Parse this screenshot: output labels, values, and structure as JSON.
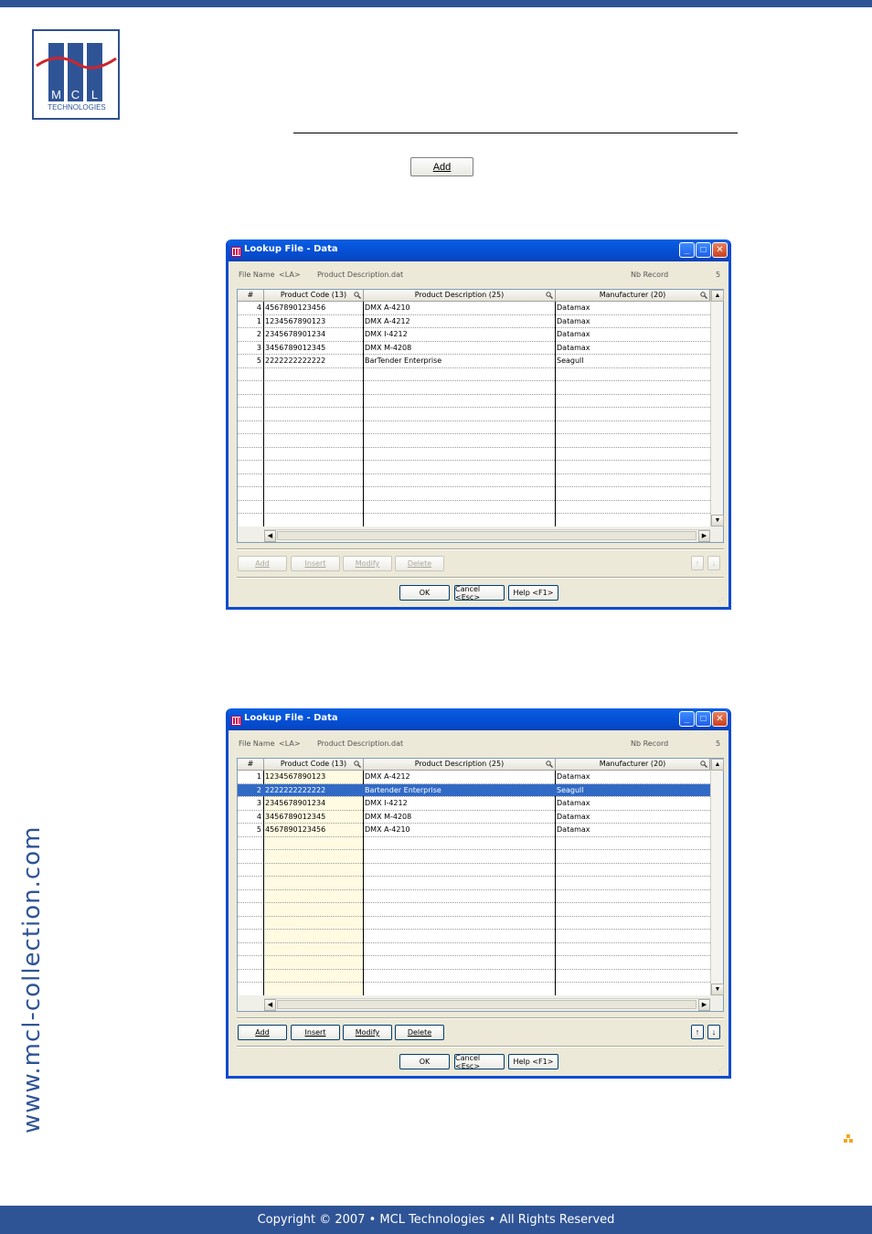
{
  "logo": {
    "letters": [
      "M",
      "C",
      "L"
    ],
    "subtitle": "TECHNOLOGIES"
  },
  "doc": {
    "add_button": "Add"
  },
  "side_url": "www.mcl-collection.com",
  "footer": "Copyright © 2007 • MCL Technologies • All Rights Reserved",
  "colors": {
    "brand": "#2f5496",
    "title_bar": "#0553d8",
    "selection": "#316ac5",
    "accent": "#f5a623"
  },
  "windows": [
    {
      "title": "Lookup File - Data",
      "file_name_label": "File Name",
      "file_name_value": "<LA>",
      "file_path": "Product Description.dat",
      "nb_record_label": "Nb Record",
      "nb_record_value": "5",
      "columns": [
        "#",
        "Product Code (13)",
        "Product Description (25)",
        "Manufacturer (20)"
      ],
      "rows": [
        [
          "4",
          "4567890123456",
          "DMX A-4210",
          "Datamax"
        ],
        [
          "1",
          "1234567890123",
          "DMX A-4212",
          "Datamax"
        ],
        [
          "2",
          "2345678901234",
          "DMX I-4212",
          "Datamax"
        ],
        [
          "3",
          "3456789012345",
          "DMX M-4208",
          "Datamax"
        ],
        [
          "5",
          "2222222222222",
          "BarTender Enterprise",
          "Seagull"
        ]
      ],
      "selected_row": -1,
      "buttons_enabled": false,
      "buttons": {
        "add": "Add",
        "insert": "Insert",
        "modify": "Modify",
        "delete": "Delete",
        "ok": "OK",
        "cancel": "Cancel <Esc>",
        "help": "Help <F1>"
      }
    },
    {
      "title": "Lookup File - Data",
      "file_name_label": "File Name",
      "file_name_value": "<LA>",
      "file_path": "Product Description.dat",
      "nb_record_label": "Nb Record",
      "nb_record_value": "5",
      "columns": [
        "#",
        "Product Code (13)",
        "Product Description (25)",
        "Manufacturer (20)"
      ],
      "rows": [
        [
          "1",
          "1234567890123",
          "DMX A-4212",
          "Datamax"
        ],
        [
          "2",
          "2222222222222",
          "Bartender Enterprise",
          "Seagull"
        ],
        [
          "3",
          "2345678901234",
          "DMX I-4212",
          "Datamax"
        ],
        [
          "4",
          "3456789012345",
          "DMX M-4208",
          "Datamax"
        ],
        [
          "5",
          "4567890123456",
          "DMX A-4210",
          "Datamax"
        ]
      ],
      "selected_row": 1,
      "buttons_enabled": true,
      "buttons": {
        "add": "Add",
        "insert": "Insert",
        "modify": "Modify",
        "delete": "Delete",
        "ok": "OK",
        "cancel": "Cancel <Esc>",
        "help": "Help <F1>"
      }
    }
  ]
}
